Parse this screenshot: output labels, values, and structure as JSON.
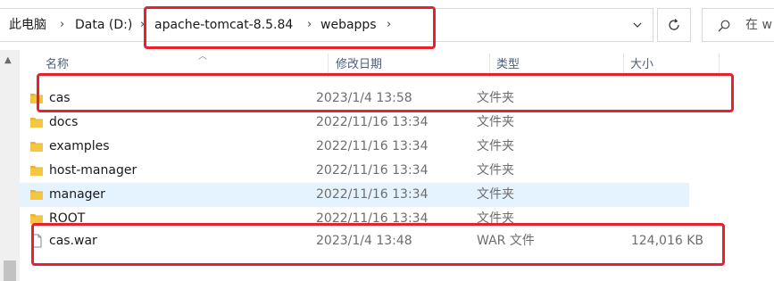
{
  "breadcrumb": {
    "items": [
      "此电脑",
      "Data (D:)",
      "apache-tomcat-8.5.84",
      "webapps"
    ],
    "separator": "›"
  },
  "toolbar": {
    "dropdown_icon": "chevron-down-icon",
    "refresh_icon": "refresh-icon"
  },
  "search": {
    "placeholder": "在 w"
  },
  "columns": {
    "name": "名称",
    "date": "修改日期",
    "type": "类型",
    "size": "大小"
  },
  "files": [
    {
      "name": "cas",
      "date": "2023/1/4 13:58",
      "type": "文件夹",
      "size": "",
      "kind": "folder",
      "highlighted": true
    },
    {
      "name": "docs",
      "date": "2022/11/16 13:34",
      "type": "文件夹",
      "size": "",
      "kind": "folder"
    },
    {
      "name": "examples",
      "date": "2022/11/16 13:34",
      "type": "文件夹",
      "size": "",
      "kind": "folder"
    },
    {
      "name": "host-manager",
      "date": "2022/11/16 13:34",
      "type": "文件夹",
      "size": "",
      "kind": "folder"
    },
    {
      "name": "manager",
      "date": "2022/11/16 13:34",
      "type": "文件夹",
      "size": "",
      "kind": "folder",
      "hover": true
    },
    {
      "name": "ROOT",
      "date": "2022/11/16 13:34",
      "type": "文件夹",
      "size": "",
      "kind": "folder"
    },
    {
      "name": "cas.war",
      "date": "2023/1/4 13:48",
      "type": "WAR 文件",
      "size": "124,016 KB",
      "kind": "file",
      "highlighted": true
    }
  ],
  "colors": {
    "annotation_red": "#e8212f",
    "hover_row": "#e5f3ff",
    "folder_yellow": "#f4c642",
    "header_text": "#4c607a"
  }
}
